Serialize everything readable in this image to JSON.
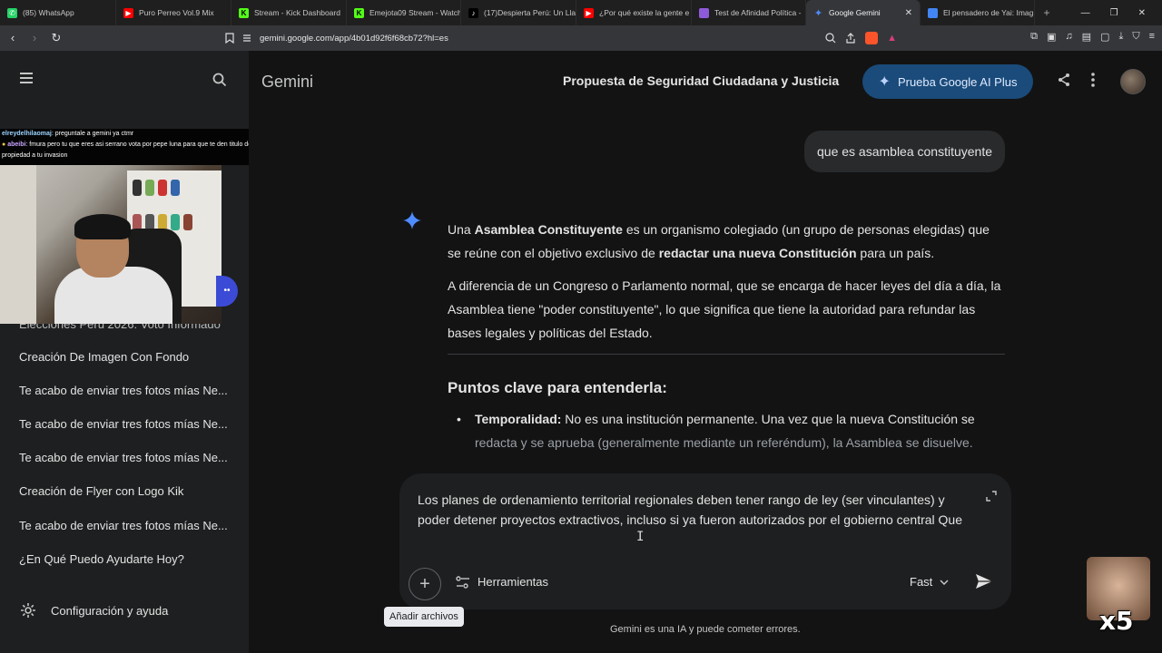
{
  "browser": {
    "tabs": [
      {
        "label": "(85) WhatsApp",
        "icon": "whatsapp-icon",
        "color": "#25d366"
      },
      {
        "label": "Puro Perreo Vol.9 Mix",
        "icon": "youtube-icon",
        "color": "#ff0000"
      },
      {
        "label": "Stream - Kick Dashboard",
        "icon": "kick-icon",
        "color": "#53fc18"
      },
      {
        "label": "Emejota09 Stream - Watch",
        "icon": "kick-icon",
        "color": "#53fc18"
      },
      {
        "label": "(17)Despierta Perú: Un Llar",
        "icon": "tiktok-icon",
        "color": "#ffffff"
      },
      {
        "label": "¿Por qué existe la gente e",
        "icon": "youtube-icon",
        "color": "#ff0000"
      },
      {
        "label": "Test de Afinidad Política -",
        "icon": "site-icon",
        "color": "#8e5bd8"
      },
      {
        "label": "Google Gemini",
        "icon": "gemini-icon",
        "color": "#4e8cff",
        "active": true
      },
      {
        "label": "El pensadero de Yai: Imag",
        "icon": "site-icon",
        "color": "#4285f4"
      }
    ],
    "url": "gemini.google.com/app/4b01d92f6f68cb72?hl=es"
  },
  "stream_overlay": {
    "chat": [
      {
        "user": "elreydelhilaomaj",
        "text": ": preguntale a gemini ya ctmr"
      },
      {
        "user": "abeibi",
        "text": ": fmura pero tu que eres asi serrano vota por pepe luna para que te den titulo de propiedad a tu invasion"
      }
    ],
    "emote_label": "x5"
  },
  "sidebar": {
    "items": [
      "Elecciones Perú 2026: Voto Informado",
      "Creación De Imagen Con Fondo",
      "Te acabo de enviar tres fotos mías Ne...",
      "Te acabo de enviar tres fotos mías Ne...",
      "Te acabo de enviar tres fotos mías Ne...",
      "Creación de Flyer con Logo Kik",
      "Te acabo de enviar tres fotos mías Ne...",
      "¿En Qué Puedo Ayudarte Hoy?"
    ],
    "settings_label": "Configuración y ayuda"
  },
  "header": {
    "brand": "Gemini",
    "title": "Propuesta de Seguridad Ciudadana y Justicia",
    "upgrade_label": "Prueba Google AI Plus"
  },
  "conversation": {
    "user_message": "que es asamblea constituyente",
    "p1_a": "Una ",
    "p1_b": "Asamblea Constituyente",
    "p1_c": " es un organismo colegiado (un grupo de personas elegidas) que se reúne con el objetivo exclusivo de ",
    "p1_d": "redactar una nueva Constitución",
    "p1_e": " para un país.",
    "p2": "A diferencia de un Congreso o Parlamento normal, que se encarga de hacer leyes del día a día, la Asamblea tiene \"poder constituyente\", lo que significa que tiene la autoridad para refundar las bases legales y políticas del Estado.",
    "heading": "Puntos clave para entenderla:",
    "bullet_label": "Temporalidad:",
    "bullet_text": " No es una institución permanente. Una vez que la nueva Constitución se",
    "bullet_text_faded": "redacta y se aprueba (generalmente mediante un referéndum), la Asamblea se disuelve."
  },
  "composer": {
    "text": "Los planes de ordenamiento territorial regionales deben tener rango de ley (ser vinculantes) y poder detener proyectos extractivos, incluso si ya fueron autorizados por el gobierno central Que",
    "tools_label": "Herramientas",
    "model_label": "Fast",
    "add_tooltip": "Añadir archivos"
  },
  "footer": {
    "disclaimer": "Gemini es una IA y puede cometer errores."
  },
  "colors": {
    "background": "#131314",
    "sidebar": "#1e1f20",
    "upgrade_button": "#1a4b7a",
    "accent_spark": "#4e8cff"
  }
}
